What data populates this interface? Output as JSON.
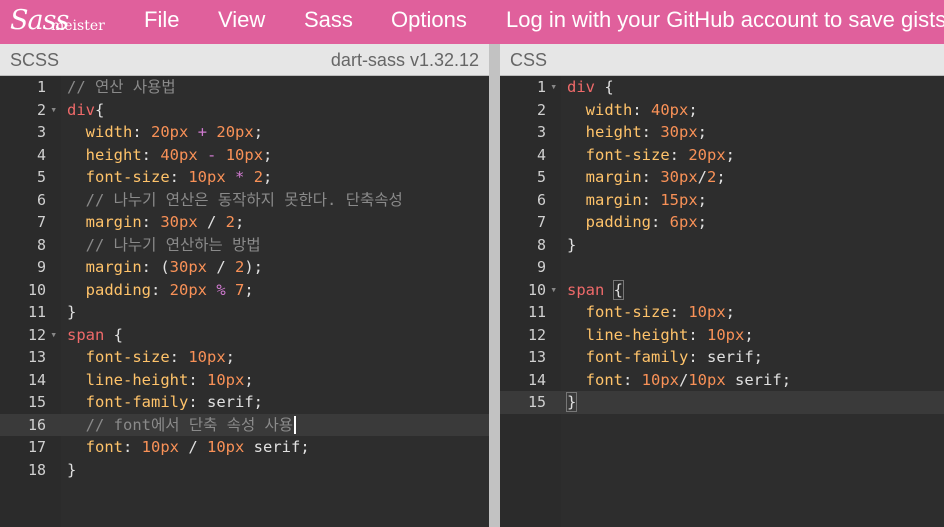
{
  "nav": {
    "logo_script": "Sass",
    "logo_word": "meister",
    "file": "File",
    "view": "View",
    "sass": "Sass",
    "options": "Options",
    "login": "Log in with your GitHub account to save gists"
  },
  "left_panel": {
    "label": "SCSS",
    "version": "dart-sass v1.32.12"
  },
  "right_panel": {
    "label": "CSS"
  },
  "colors": {
    "nav_bg": "#e0609c",
    "editor_bg": "#2d2d2d",
    "property": "#ffc36a",
    "number": "#f99157",
    "selector": "#ef6a6a",
    "comment": "#8a8a8a",
    "operator": "#d07ad0"
  },
  "scss_lines": [
    {
      "n": "1",
      "tokens": [
        [
          "c",
          "// 연산 사용법"
        ]
      ]
    },
    {
      "n": "2",
      "fold": true,
      "tokens": [
        [
          "tag",
          "div"
        ],
        [
          "pun",
          "{"
        ]
      ]
    },
    {
      "n": "3",
      "tokens": [
        [
          "pun",
          "  "
        ],
        [
          "prop",
          "width"
        ],
        [
          "pun",
          ": "
        ],
        [
          "num",
          "20px"
        ],
        [
          "pun",
          " "
        ],
        [
          "op",
          "+"
        ],
        [
          "pun",
          " "
        ],
        [
          "num",
          "20px"
        ],
        [
          "pun",
          ";"
        ]
      ]
    },
    {
      "n": "4",
      "tokens": [
        [
          "pun",
          "  "
        ],
        [
          "prop",
          "height"
        ],
        [
          "pun",
          ": "
        ],
        [
          "num",
          "40px"
        ],
        [
          "pun",
          " "
        ],
        [
          "op",
          "-"
        ],
        [
          "pun",
          " "
        ],
        [
          "num",
          "10px"
        ],
        [
          "pun",
          ";"
        ]
      ]
    },
    {
      "n": "5",
      "tokens": [
        [
          "pun",
          "  "
        ],
        [
          "prop",
          "font-size"
        ],
        [
          "pun",
          ": "
        ],
        [
          "num",
          "10px"
        ],
        [
          "pun",
          " "
        ],
        [
          "op",
          "*"
        ],
        [
          "pun",
          " "
        ],
        [
          "num",
          "2"
        ],
        [
          "pun",
          ";"
        ]
      ]
    },
    {
      "n": "6",
      "tokens": [
        [
          "pun",
          "  "
        ],
        [
          "c",
          "// 나누기 연산은 동작하지 못한다. 단축속성"
        ]
      ]
    },
    {
      "n": "7",
      "tokens": [
        [
          "pun",
          "  "
        ],
        [
          "prop",
          "margin"
        ],
        [
          "pun",
          ": "
        ],
        [
          "num",
          "30px"
        ],
        [
          "pun",
          " / "
        ],
        [
          "num",
          "2"
        ],
        [
          "pun",
          ";"
        ]
      ]
    },
    {
      "n": "8",
      "tokens": [
        [
          "pun",
          "  "
        ],
        [
          "c",
          "// 나누기 연산하는 방법"
        ]
      ]
    },
    {
      "n": "9",
      "tokens": [
        [
          "pun",
          "  "
        ],
        [
          "prop",
          "margin"
        ],
        [
          "pun",
          ": ("
        ],
        [
          "num",
          "30px"
        ],
        [
          "pun",
          " / "
        ],
        [
          "num",
          "2"
        ],
        [
          "pun",
          ");"
        ]
      ]
    },
    {
      "n": "10",
      "tokens": [
        [
          "pun",
          "  "
        ],
        [
          "prop",
          "padding"
        ],
        [
          "pun",
          ": "
        ],
        [
          "num",
          "20px"
        ],
        [
          "pun",
          " "
        ],
        [
          "op",
          "%"
        ],
        [
          "pun",
          " "
        ],
        [
          "num",
          "7"
        ],
        [
          "pun",
          ";"
        ]
      ]
    },
    {
      "n": "11",
      "tokens": [
        [
          "pun",
          "}"
        ]
      ]
    },
    {
      "n": "12",
      "fold": true,
      "tokens": [
        [
          "tag",
          "span"
        ],
        [
          "pun",
          " {"
        ]
      ]
    },
    {
      "n": "13",
      "tokens": [
        [
          "pun",
          "  "
        ],
        [
          "prop",
          "font-size"
        ],
        [
          "pun",
          ": "
        ],
        [
          "num",
          "10px"
        ],
        [
          "pun",
          ";"
        ]
      ]
    },
    {
      "n": "14",
      "tokens": [
        [
          "pun",
          "  "
        ],
        [
          "prop",
          "line-height"
        ],
        [
          "pun",
          ": "
        ],
        [
          "num",
          "10px"
        ],
        [
          "pun",
          ";"
        ]
      ]
    },
    {
      "n": "15",
      "tokens": [
        [
          "pun",
          "  "
        ],
        [
          "prop",
          "font-family"
        ],
        [
          "pun",
          ": "
        ],
        [
          "kw",
          "serif"
        ],
        [
          "pun",
          ";"
        ]
      ]
    },
    {
      "n": "16",
      "active": true,
      "cursor": true,
      "tokens": [
        [
          "pun",
          "  "
        ],
        [
          "c",
          "// font에서 단축 속성 사용"
        ]
      ]
    },
    {
      "n": "17",
      "tokens": [
        [
          "pun",
          "  "
        ],
        [
          "prop",
          "font"
        ],
        [
          "pun",
          ": "
        ],
        [
          "num",
          "10px"
        ],
        [
          "pun",
          " / "
        ],
        [
          "num",
          "10px"
        ],
        [
          "pun",
          " "
        ],
        [
          "kw",
          "serif"
        ],
        [
          "pun",
          ";"
        ]
      ]
    },
    {
      "n": "18",
      "tokens": [
        [
          "pun",
          "}"
        ]
      ]
    }
  ],
  "css_lines": [
    {
      "n": "1",
      "fold": true,
      "tokens": [
        [
          "tag",
          "div"
        ],
        [
          "pun",
          " {"
        ]
      ]
    },
    {
      "n": "2",
      "tokens": [
        [
          "pun",
          "  "
        ],
        [
          "prop",
          "width"
        ],
        [
          "pun",
          ": "
        ],
        [
          "num",
          "40px"
        ],
        [
          "pun",
          ";"
        ]
      ]
    },
    {
      "n": "3",
      "tokens": [
        [
          "pun",
          "  "
        ],
        [
          "prop",
          "height"
        ],
        [
          "pun",
          ": "
        ],
        [
          "num",
          "30px"
        ],
        [
          "pun",
          ";"
        ]
      ]
    },
    {
      "n": "4",
      "tokens": [
        [
          "pun",
          "  "
        ],
        [
          "prop",
          "font-size"
        ],
        [
          "pun",
          ": "
        ],
        [
          "num",
          "20px"
        ],
        [
          "pun",
          ";"
        ]
      ]
    },
    {
      "n": "5",
      "tokens": [
        [
          "pun",
          "  "
        ],
        [
          "prop",
          "margin"
        ],
        [
          "pun",
          ": "
        ],
        [
          "num",
          "30px"
        ],
        [
          "pun",
          "/"
        ],
        [
          "num",
          "2"
        ],
        [
          "pun",
          ";"
        ]
      ]
    },
    {
      "n": "6",
      "tokens": [
        [
          "pun",
          "  "
        ],
        [
          "prop",
          "margin"
        ],
        [
          "pun",
          ": "
        ],
        [
          "num",
          "15px"
        ],
        [
          "pun",
          ";"
        ]
      ]
    },
    {
      "n": "7",
      "tokens": [
        [
          "pun",
          "  "
        ],
        [
          "prop",
          "padding"
        ],
        [
          "pun",
          ": "
        ],
        [
          "num",
          "6px"
        ],
        [
          "pun",
          ";"
        ]
      ]
    },
    {
      "n": "8",
      "tokens": [
        [
          "pun",
          "}"
        ]
      ]
    },
    {
      "n": "9",
      "tokens": []
    },
    {
      "n": "10",
      "fold": true,
      "tokens": [
        [
          "tag",
          "span"
        ],
        [
          "pun",
          " "
        ],
        [
          "brk",
          "{"
        ]
      ]
    },
    {
      "n": "11",
      "tokens": [
        [
          "pun",
          "  "
        ],
        [
          "prop",
          "font-size"
        ],
        [
          "pun",
          ": "
        ],
        [
          "num",
          "10px"
        ],
        [
          "pun",
          ";"
        ]
      ]
    },
    {
      "n": "12",
      "tokens": [
        [
          "pun",
          "  "
        ],
        [
          "prop",
          "line-height"
        ],
        [
          "pun",
          ": "
        ],
        [
          "num",
          "10px"
        ],
        [
          "pun",
          ";"
        ]
      ]
    },
    {
      "n": "13",
      "tokens": [
        [
          "pun",
          "  "
        ],
        [
          "prop",
          "font-family"
        ],
        [
          "pun",
          ": "
        ],
        [
          "kw",
          "serif"
        ],
        [
          "pun",
          ";"
        ]
      ]
    },
    {
      "n": "14",
      "tokens": [
        [
          "pun",
          "  "
        ],
        [
          "prop",
          "font"
        ],
        [
          "pun",
          ": "
        ],
        [
          "num",
          "10px"
        ],
        [
          "pun",
          "/"
        ],
        [
          "num",
          "10px"
        ],
        [
          "pun",
          " "
        ],
        [
          "kw",
          "serif"
        ],
        [
          "pun",
          ";"
        ]
      ]
    },
    {
      "n": "15",
      "active": true,
      "tokens": [
        [
          "brk",
          "}"
        ]
      ]
    }
  ]
}
